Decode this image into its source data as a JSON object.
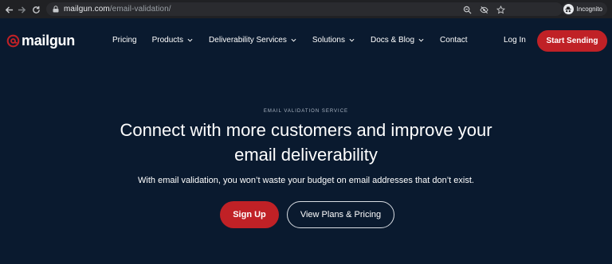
{
  "browser": {
    "url_host": "mailgun.com",
    "url_path": "/email-validation/",
    "profile_label": "Incognito",
    "icons": [
      "back-icon",
      "forward-icon",
      "reload-icon",
      "lock-icon",
      "zoom-icon",
      "eye-off-icon",
      "star-icon",
      "incognito-icon"
    ]
  },
  "header": {
    "logo_text": "mailgun",
    "nav": [
      {
        "label": "Pricing",
        "has_dropdown": false
      },
      {
        "label": "Products",
        "has_dropdown": true
      },
      {
        "label": "Deliverability Services",
        "has_dropdown": true
      },
      {
        "label": "Solutions",
        "has_dropdown": true
      },
      {
        "label": "Docs & Blog",
        "has_dropdown": true
      },
      {
        "label": "Contact",
        "has_dropdown": false
      }
    ],
    "login_label": "Log In",
    "cta_label": "Start Sending"
  },
  "hero": {
    "eyebrow": "EMAIL VALIDATION SERVICE",
    "headline_line1": "Connect with more customers and improve your",
    "headline_line2": "email deliverability",
    "subtext": "With email validation, you won’t waste your budget on email addresses that don’t exist.",
    "primary_button": "Sign Up",
    "secondary_button": "View Plans & Pricing"
  },
  "colors": {
    "page_bg": "#0a1a2f",
    "accent": "#c02126",
    "chrome_bg": "#202124"
  }
}
